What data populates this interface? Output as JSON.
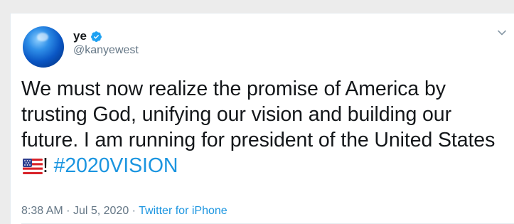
{
  "tweet": {
    "display_name": "ye",
    "handle": "@kanyewest",
    "verified": true,
    "text_main": "We must now realize the promise of America by trusting God, unifying our vision and building our future. I am running for president of the United States ",
    "text_after_flag": "! ",
    "flag_emoji": "us-flag-icon",
    "hashtag": "#2020VISION",
    "time": "8:38 AM",
    "separator": "·",
    "date": "Jul 5, 2020",
    "source": "Twitter for iPhone"
  },
  "icons": {
    "avatar": "blue-globe-avatar",
    "verified": "verified-badge-icon",
    "more": "chevron-down-icon"
  },
  "colors": {
    "link": "#1b95e0",
    "text": "#14171a",
    "secondary": "#657786",
    "verified": "#1da1f2"
  }
}
